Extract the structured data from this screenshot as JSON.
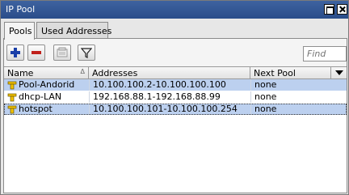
{
  "window": {
    "title": "IP Pool"
  },
  "tabs": [
    {
      "label": "Pools",
      "active": true
    },
    {
      "label": "Used Addresses",
      "active": false
    }
  ],
  "toolbar": {
    "add_icon": "plus-icon",
    "remove_icon": "minus-icon",
    "comment_icon": "comment-icon",
    "filter_icon": "filter-icon",
    "find_placeholder": "Find"
  },
  "table": {
    "columns": [
      "Name",
      "Addresses",
      "Next Pool"
    ],
    "sort_indicator": "Δ",
    "rows": [
      {
        "name": "Pool-Andorid",
        "addresses": "10.100.100.2-10.100.100.100",
        "next_pool": "none",
        "selected": true
      },
      {
        "name": "dhcp-LAN",
        "addresses": "192.168.88.1-192.168.88.99",
        "next_pool": "none",
        "selected": false
      },
      {
        "name": "hotspot",
        "addresses": "10.100.100.101-10.100.100.254",
        "next_pool": "none",
        "selected": true
      }
    ]
  },
  "colors": {
    "titlebar": "#2f538f",
    "selection": "#bcd0ef",
    "add": "#1a3fa8",
    "remove": "#c0201a"
  }
}
